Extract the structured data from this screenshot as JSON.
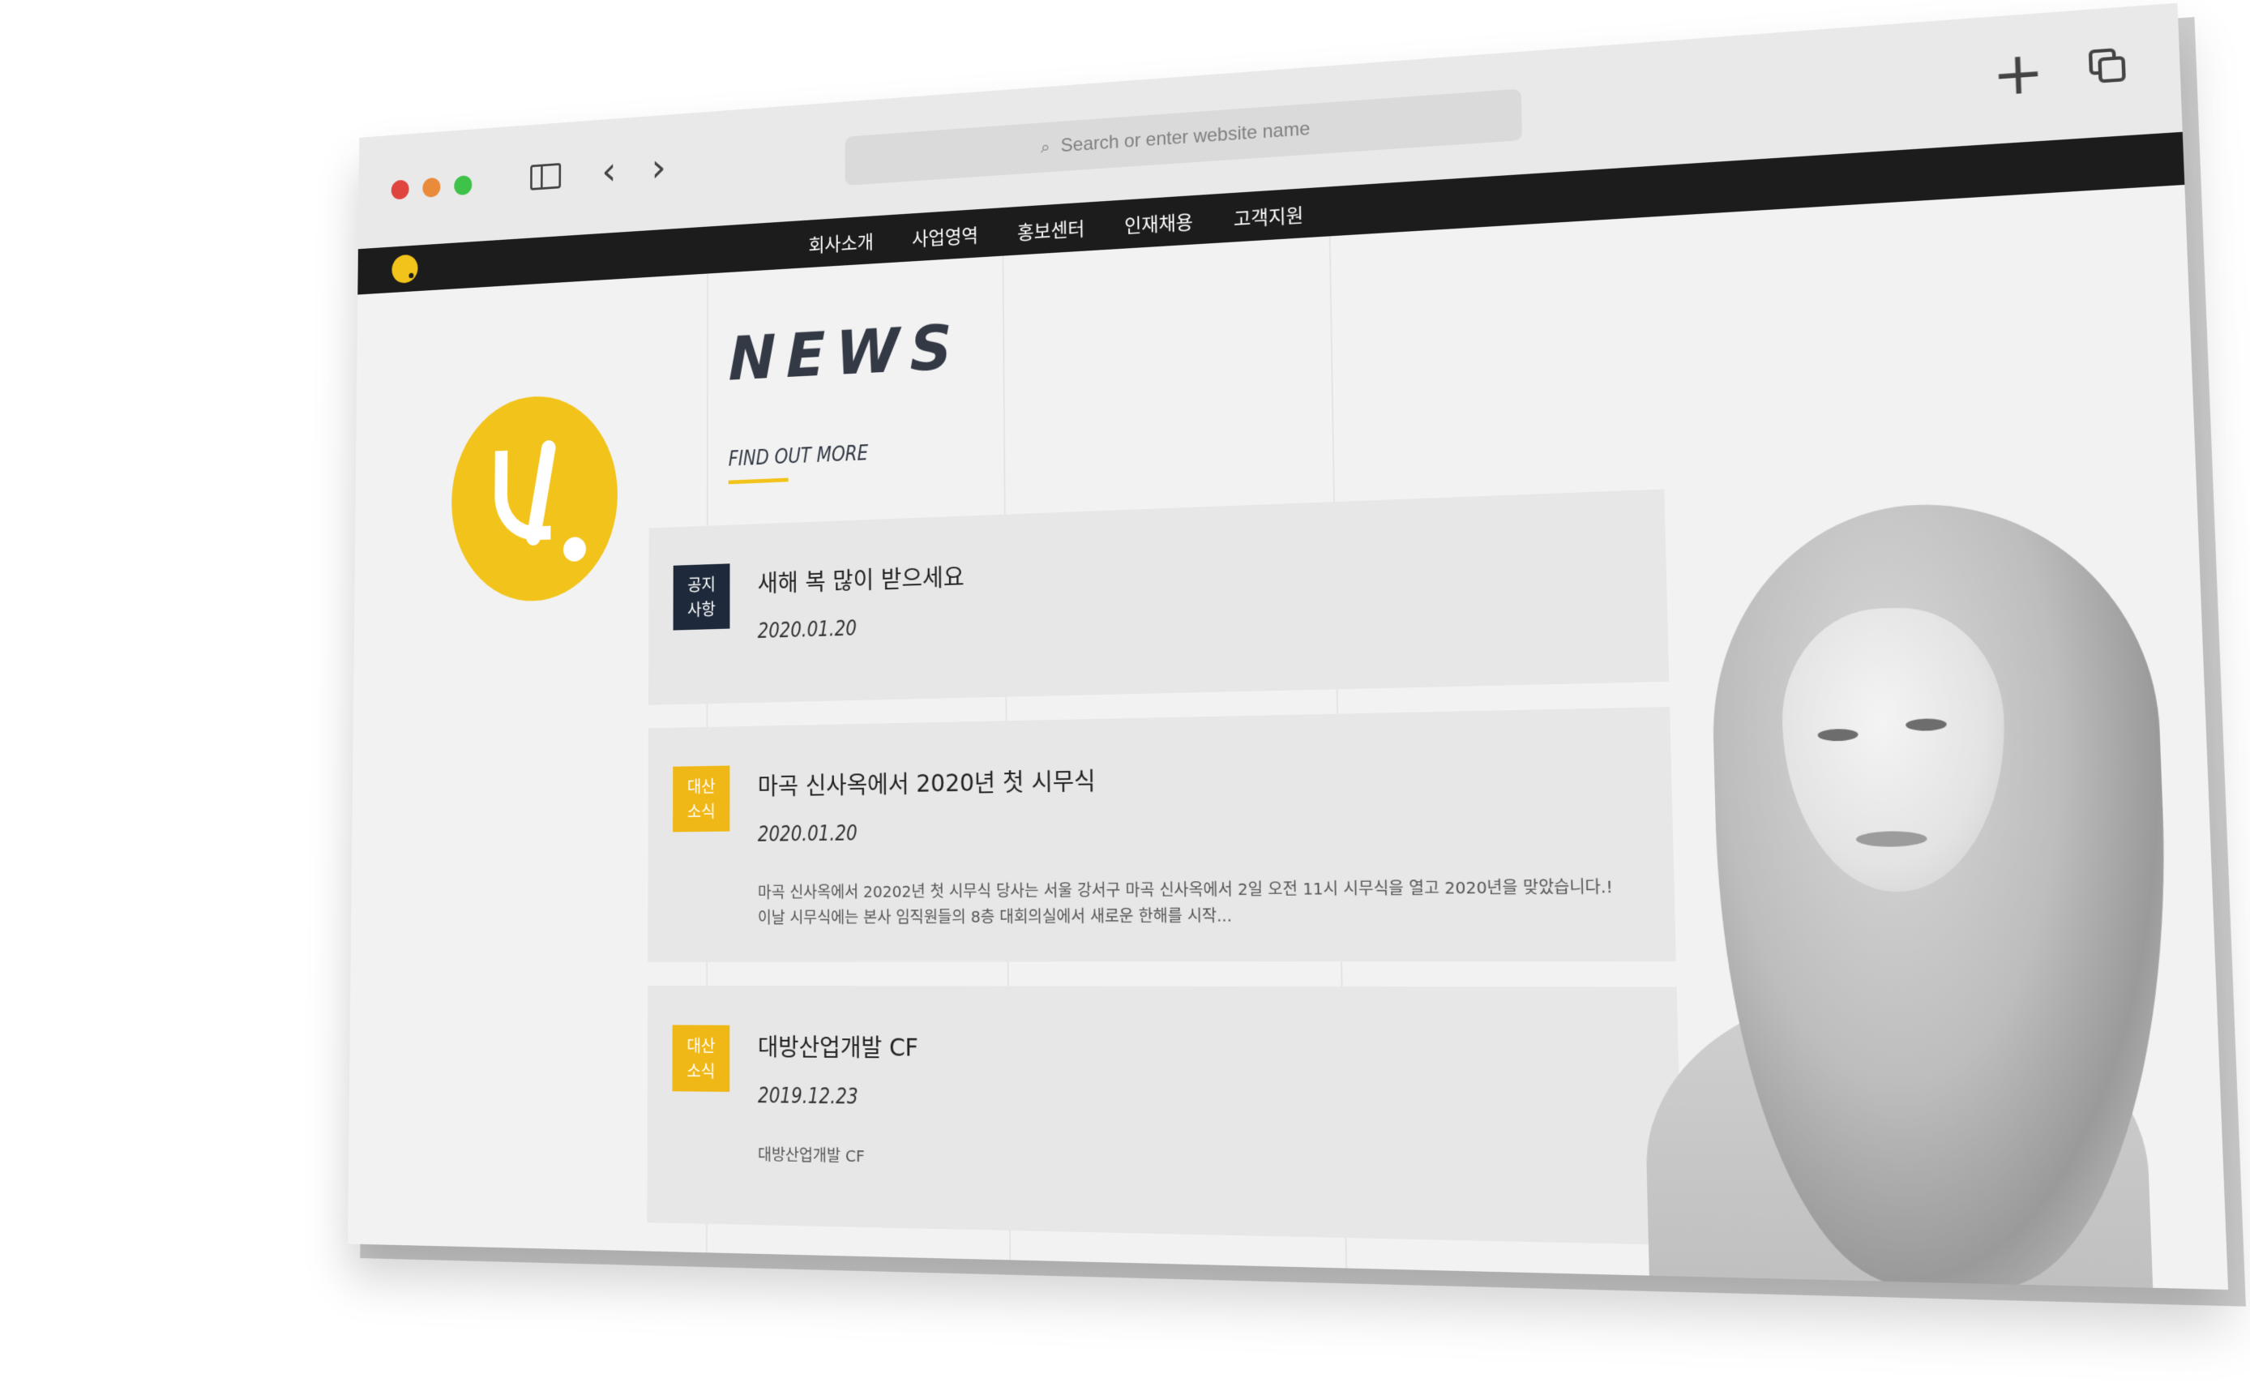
{
  "browser": {
    "address_placeholder": "Search or enter website name",
    "nav_back_glyph": "‹",
    "nav_forward_glyph": "›",
    "new_tab_glyph": "+",
    "icons": {
      "back": "chevron-left-icon",
      "forward": "chevron-right-icon",
      "sidebar": "sidebar-icon",
      "search": "search-icon",
      "new_tab": "plus-icon",
      "tabs": "tabs-icon"
    }
  },
  "site": {
    "brand_color": "#f2c31a",
    "nav": [
      {
        "label": "회사소개"
      },
      {
        "label": "사업영역"
      },
      {
        "label": "홍보센터"
      },
      {
        "label": "인재채용"
      },
      {
        "label": "고객지원"
      }
    ],
    "section_title": "NEWS",
    "find_more": "FIND OUT MORE"
  },
  "news": [
    {
      "badge": "공지\n사항",
      "badge_color": "#1e2a3b",
      "title": "새해 복 많이 받으세요",
      "date": "2020.01.20",
      "excerpt": ""
    },
    {
      "badge": "대산\n소식",
      "badge_color": "#efb817",
      "title": "마곡 신사옥에서 2020년 첫 시무식",
      "date": "2020.01.20",
      "excerpt": "마곡 신사옥에서 20202년 첫 시무식 당사는 서울 강서구 마곡 신사옥에서 2일 오전 11시 시무식을 열고 2020년을 맞았습니다.! 이날 시무식에는 본사 임직원들의 8층 대회의실에서 새로운 한해를 시작..."
    },
    {
      "badge": "대산\n소식",
      "badge_color": "#efb817",
      "title": "대방산업개발 CF",
      "date": "2019.12.23",
      "excerpt": "대방산업개발 CF"
    }
  ]
}
